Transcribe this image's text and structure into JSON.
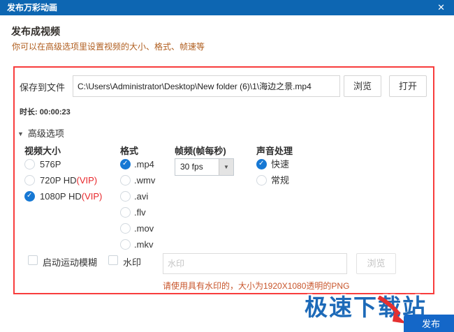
{
  "window": {
    "title": "发布万彩动画",
    "close_glyph": "✕"
  },
  "header": {
    "title": "发布成视频",
    "subtitle": "你可以在高级选项里设置视频的大小、格式、帧速等"
  },
  "save": {
    "label": "保存到文件",
    "path": "C:\\Users\\Administrator\\Desktop\\New folder (6)\\1\\海边之景.mp4",
    "browse_label": "浏览",
    "open_label": "打开"
  },
  "duration_text": "时长: 00:00:23",
  "advanced": {
    "label": "高级选项",
    "collapse_glyph": "▼"
  },
  "video_size": {
    "header": "视频大小",
    "options": [
      {
        "label": "576P",
        "vip": "",
        "checked": false
      },
      {
        "label": "720P HD",
        "vip": "(VIP)",
        "checked": false
      },
      {
        "label": "1080P HD",
        "vip": "(VIP)",
        "checked": true
      }
    ]
  },
  "format": {
    "header": "格式",
    "options": [
      {
        "label": ".mp4",
        "checked": true
      },
      {
        "label": ".wmv",
        "checked": false
      },
      {
        "label": ".avi",
        "checked": false
      },
      {
        "label": ".flv",
        "checked": false
      },
      {
        "label": ".mov",
        "checked": false
      },
      {
        "label": ".mkv",
        "checked": false
      }
    ]
  },
  "framerate": {
    "header": "帧频(帧每秒)",
    "value": "30 fps",
    "drop_glyph": "▼"
  },
  "sound": {
    "header": "声音处理",
    "options": [
      {
        "label": "快速",
        "checked": true
      },
      {
        "label": "常规",
        "checked": false
      }
    ]
  },
  "watermark_row": {
    "motion_blur_label": "启动运动模糊",
    "watermark_label": "水印",
    "input_placeholder": "水印",
    "browse_label": "浏览"
  },
  "note": "请使用具有水印的，大小为1920X1080透明的PNG",
  "footer": {
    "site_watermark": "极速下载站",
    "publish_label": "发布"
  },
  "colors": {
    "titlebar_blue": "#0d66b2",
    "accent_blue": "#1678d4",
    "publish_blue": "#1467c8",
    "highlight_red": "#f83c3c",
    "vip_red": "#e8262a",
    "subtitle_orange": "#b05e1f",
    "note_orange": "#c8552b"
  }
}
